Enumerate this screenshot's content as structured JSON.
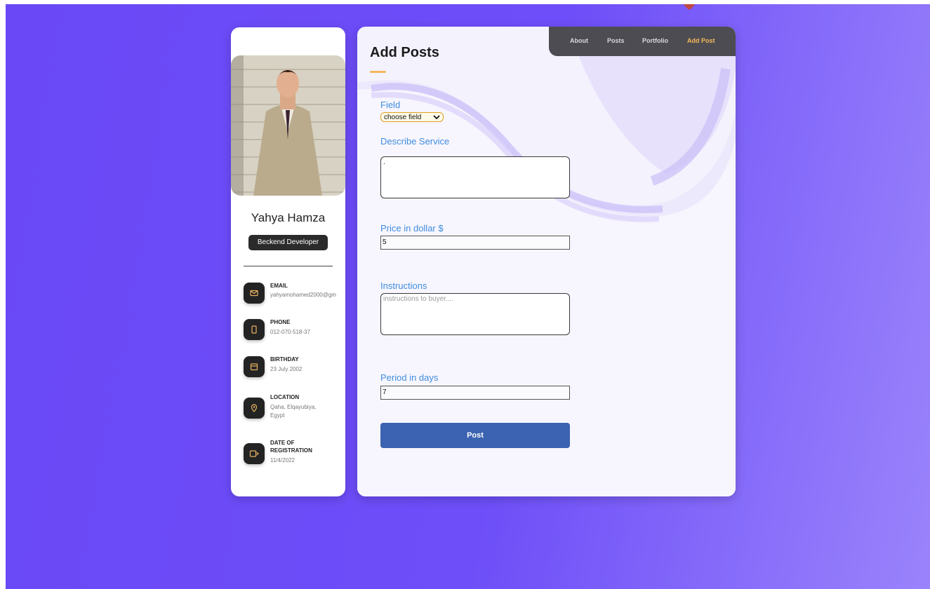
{
  "nav": {
    "items": [
      {
        "label": "About"
      },
      {
        "label": "Posts"
      },
      {
        "label": "Portfolio"
      },
      {
        "label": "Add Post"
      }
    ],
    "active_color": "#f3b85a"
  },
  "profile": {
    "name": "Yahya Hamza",
    "role": "Beckend Developer",
    "contacts": [
      {
        "title": "EMAIL",
        "value": "yahyamohamed2000@gm",
        "icon": "mail-icon"
      },
      {
        "title": "PHONE",
        "value": "012-070-518-37",
        "icon": "phone-icon"
      },
      {
        "title": "BIRTHDAY",
        "value": "23 July 2002",
        "icon": "calendar-icon"
      },
      {
        "title": "LOCATION",
        "value": "Qaha, Elqayubiya,",
        "value2": "Egypt",
        "icon": "location-pin-icon"
      },
      {
        "title": "DATE OF",
        "title2": "REGISTRATION",
        "value": "11/4/2022",
        "icon": "calendar-arrow-icon"
      }
    ]
  },
  "form": {
    "title": "Add Posts",
    "field_label": "Field",
    "field_selected": "choose field",
    "describe_label": "Describe Service",
    "describe_value": ".",
    "price_label": "Price in dollar $",
    "price_value": "5",
    "instructions_label": "Instructions",
    "instructions_placeholder": "instructions to buyer....",
    "period_label": "Period in days",
    "period_value": "7",
    "submit_label": "Post"
  },
  "colors": {
    "accent": "#f5b75b",
    "label_blue": "#3f8ee0",
    "button_blue": "#3c63b1",
    "background": "#6a48f6"
  }
}
